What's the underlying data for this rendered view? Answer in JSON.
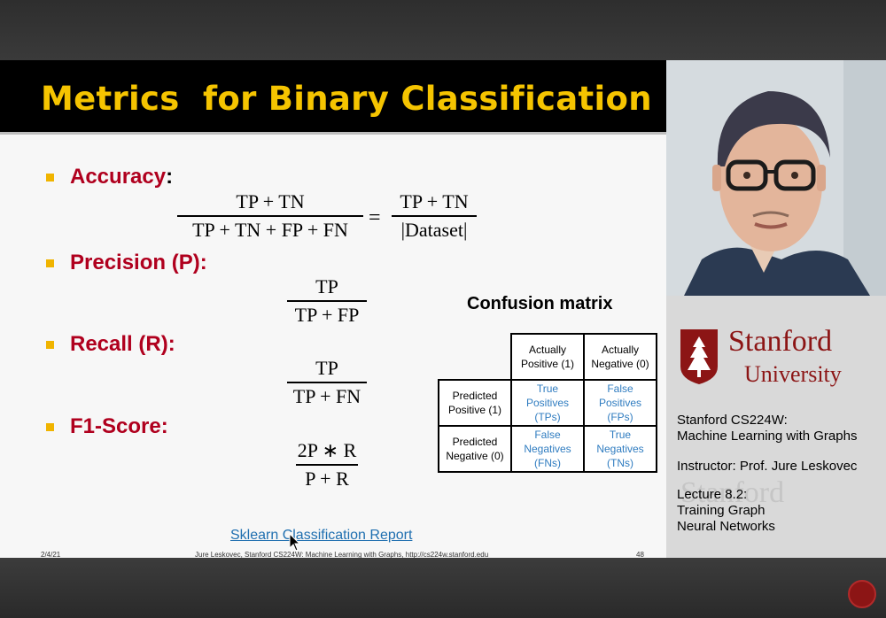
{
  "slide": {
    "title": "Metrics  for Binary Classification",
    "bullets": [
      {
        "label": "Accuracy",
        "suffix": ":"
      },
      {
        "label": "Precision (P):",
        "suffix": ""
      },
      {
        "label": "Recall (R):",
        "suffix": ""
      },
      {
        "label": "F1-Score:",
        "suffix": ""
      }
    ],
    "formulas": {
      "accuracy_num": "TP + TN",
      "accuracy_den": "TP + TN + FP + FN",
      "accuracy_eq": "=",
      "accuracy2_num": "TP + TN",
      "accuracy2_den": "|Dataset|",
      "precision_num": "TP",
      "precision_den": "TP + FP",
      "recall_num": "TP",
      "recall_den": "TP + FN",
      "f1_num": "2P ∗ R",
      "f1_den": "P + R"
    },
    "confusion_matrix": {
      "title": "Confusion matrix",
      "col_headers": [
        "Actually\nPositive (1)",
        "Actually\nNegative (0)"
      ],
      "rows": [
        {
          "header": "Predicted\nPositive (1)",
          "cells": [
            "True\nPositives\n(TPs)",
            "False\nPositives\n(FPs)"
          ]
        },
        {
          "header": "Predicted\nNegative (0)",
          "cells": [
            "False\nNegatives\n(FNs)",
            "True\nNegatives\n(TNs)"
          ]
        }
      ]
    },
    "link": "Sklearn Classification Report",
    "footer": {
      "date": "2/4/21",
      "citation": "Jure Leskovec, Stanford CS224W: Machine Learning with Graphs, http://cs224w.stanford.edu",
      "page": "48"
    }
  },
  "panel": {
    "stanford": "Stanford",
    "university": "University",
    "course": "Stanford CS224W:\nMachine Learning with Graphs",
    "instructor": "Instructor: Prof. Jure Leskovec",
    "lecture": "Lecture 8.2:\nTraining Graph\nNeural Networks",
    "watermark": "Stanford"
  },
  "colors": {
    "title_yellow": "#f5c400",
    "bullet_red": "#b0001e",
    "cardinal": "#8c1515",
    "matrix_blue": "#2f7cc0"
  }
}
